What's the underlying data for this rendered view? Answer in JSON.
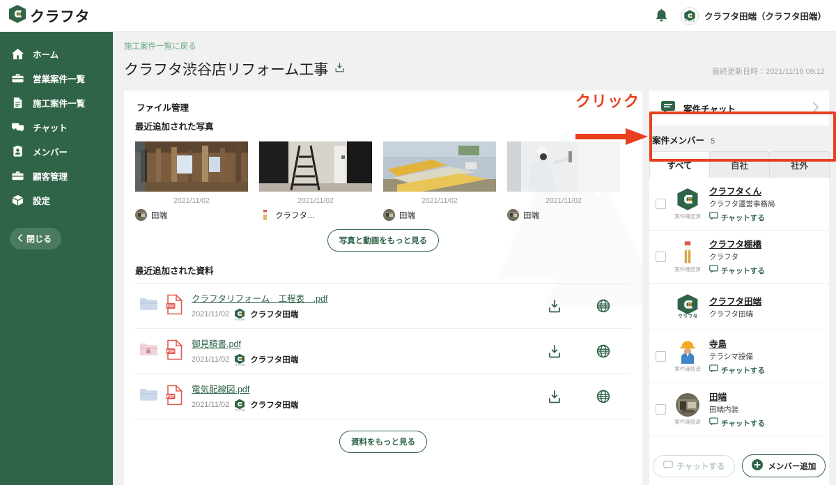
{
  "brand": {
    "name": "クラフタ",
    "logo_icon": "crafta-c-logo-icon"
  },
  "topbar": {
    "bell_icon": "notification-bell-icon",
    "user_name": "クラフタ田端（クラフタ田端）",
    "user_avatar_icon": "user-avatar-icon"
  },
  "sidebar": {
    "items": [
      {
        "label": "ホーム",
        "icon": "home-icon"
      },
      {
        "label": "営業案件一覧",
        "icon": "briefcase-icon"
      },
      {
        "label": "施工案件一覧",
        "icon": "document-icon"
      },
      {
        "label": "チャット",
        "icon": "chat-bubbles-icon"
      },
      {
        "label": "メンバー",
        "icon": "id-card-icon"
      },
      {
        "label": "顧客管理",
        "icon": "briefcase-icon"
      },
      {
        "label": "設定",
        "icon": "box-icon"
      }
    ],
    "close_label": "閉じる",
    "close_icon": "chevron-left-icon"
  },
  "content": {
    "breadcrumb": "施工案件一覧に戻る",
    "page_title": "クラフタ渋谷店リフォーム工事",
    "title_icon": "download-box-icon",
    "updated": "最終更新日時：2021/11/16 09:12",
    "file_management_label": "ファイル管理"
  },
  "photos": {
    "section_label": "最近追加された写真",
    "items": [
      {
        "date": "2021/11/02",
        "author": "田端",
        "avatar_icon": "photo-avatar-icon",
        "thumb": "demolition-interior-photo"
      },
      {
        "date": "2021/11/02",
        "author": "クラフタ…",
        "avatar_icon": "person-standing-avatar-icon",
        "thumb": "ladder-hallway-photo"
      },
      {
        "date": "2021/11/02",
        "author": "田端",
        "avatar_icon": "photo-avatar-icon",
        "thumb": "insulation-materials-photo"
      },
      {
        "date": "2021/11/02",
        "author": "田端",
        "avatar_icon": "photo-avatar-icon",
        "thumb": "worker-wall-photo"
      }
    ],
    "more_button": "写真と動画をもっと見る"
  },
  "documents": {
    "section_label": "最近追加された資料",
    "rows": [
      {
        "folder_icon": "folder-blue-icon",
        "file_icon": "pdf-file-icon",
        "name": "クラフタリフォーム　工程表　.pdf",
        "date": "2021/11/02",
        "owner": "クラフタ田端",
        "owner_avatar_icon": "crafta-mini-logo-icon",
        "download_icon": "download-icon",
        "globe_icon": "globe-icon"
      },
      {
        "folder_icon": "folder-pink-lock-icon",
        "file_icon": "pdf-file-icon",
        "name": "御見積書.pdf",
        "date": "2021/11/02",
        "owner": "クラフタ田端",
        "owner_avatar_icon": "crafta-mini-logo-icon",
        "download_icon": "download-icon",
        "globe_icon": "globe-icon"
      },
      {
        "folder_icon": "folder-blue-icon",
        "file_icon": "pdf-file-icon",
        "name": "電気配線図.pdf",
        "date": "2021/11/02",
        "owner": "クラフタ田端",
        "owner_avatar_icon": "crafta-mini-logo-icon",
        "download_icon": "download-icon",
        "globe_icon": "globe-icon"
      }
    ],
    "more_button": "資料をもっと見る"
  },
  "right_panel": {
    "chat_card": {
      "label": "案件チャット",
      "icon": "chat-message-icon",
      "chevron_icon": "chevron-right-icon"
    },
    "members_title": "案件メンバー",
    "members_count": "5",
    "tabs": [
      {
        "label": "すべて",
        "active": true
      },
      {
        "label": "自社",
        "active": false
      },
      {
        "label": "社外",
        "active": false
      }
    ],
    "members": [
      {
        "name": "クラフタくん",
        "org": "クラフタ運営事務局",
        "confirm": "案件確認済",
        "chat_label": "チャットする",
        "chat_icon": "chat-message-icon",
        "avatar_icon": "crafta-c-logo-icon",
        "has_checkbox": true,
        "has_chat": true
      },
      {
        "name": "クラフタ棚橋",
        "org": "クラフタ",
        "confirm": "案件確認済",
        "chat_label": "チャットする",
        "chat_icon": "chat-message-icon",
        "avatar_icon": "person-standing-avatar-icon",
        "has_checkbox": true,
        "has_chat": true
      },
      {
        "name": "クラフタ田端",
        "org": "クラフタ田端",
        "confirm": "",
        "chat_label": "",
        "chat_icon": "",
        "avatar_icon": "crafta-mini-logo-icon",
        "has_checkbox": false,
        "has_chat": false
      },
      {
        "name": "寺島",
        "org": "テラシマ設備",
        "confirm": "案件確認済",
        "chat_label": "チャットする",
        "chat_icon": "chat-message-icon",
        "avatar_icon": "construction-worker-avatar-icon",
        "has_checkbox": true,
        "has_chat": true
      },
      {
        "name": "田端",
        "org": "田端内装",
        "confirm": "案件確認済",
        "chat_label": "チャットする",
        "chat_icon": "chat-message-icon",
        "avatar_icon": "photo-avatar-icon",
        "has_checkbox": true,
        "has_chat": true
      }
    ],
    "chat_button": "チャットする",
    "chat_button_icon": "chat-message-icon",
    "add_member_button": "メンバー追加",
    "add_member_icon": "plus-circle-icon"
  },
  "annotation": {
    "click_label": "クリック",
    "arrow_icon": "right-arrow-annotation-icon",
    "highlight_color": "#e8401f"
  },
  "colors": {
    "brand_green": "#2f6448",
    "sidebar_green": "#2f6448",
    "page_bg": "#f1f1f1",
    "accent_red": "#e8401f",
    "link_green": "#2f6448",
    "muted_text": "#9a9a9a"
  }
}
